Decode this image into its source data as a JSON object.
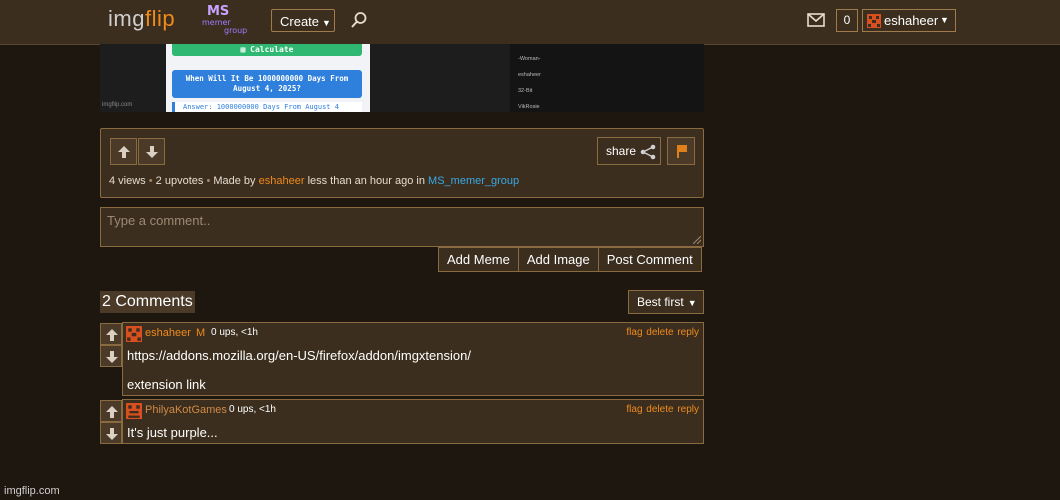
{
  "header": {
    "logo_img": "img",
    "logo_flip": "flip",
    "group_logo": {
      "ms": "MS",
      "line1": "memer",
      "line2": "group"
    },
    "create_label": "Create",
    "notification_count": "0",
    "username": "eshaheer",
    "icons": [
      "search-icon",
      "mail-icon",
      "avatar-icon",
      "caret-down-icon"
    ]
  },
  "meme": {
    "calculate_label": "▦ Calculate",
    "question": "When Will It Be 1000000000 Days From August 4, 2025?",
    "answer": "Answer: 1000000000 Days From August 4",
    "watermark": "imgflip.com",
    "sidebar": [
      "-Woman-",
      "eshaheer",
      "32-Bit",
      "VikRosie"
    ]
  },
  "post": {
    "views": "4 views",
    "upvotes": "2 upvotes",
    "made_by": "Made by",
    "author": "eshaheer",
    "time": "less than an hour ago in",
    "group": "MS_memer_group",
    "share_label": "share",
    "icons": [
      "upvote-icon",
      "downvote-icon",
      "share-icon",
      "flag-icon"
    ]
  },
  "comment_form": {
    "placeholder": "Type a comment..",
    "buttons": [
      "Add Meme",
      "Add Image",
      "Post Comment"
    ]
  },
  "comments_section": {
    "count_label": "2 Comments",
    "sort_label": "Best first",
    "comments": [
      {
        "user": "eshaheer",
        "badge": "M",
        "meta": "0 ups, <1h",
        "links": "flag delete reply",
        "lines": [
          "https://addons.mozilla.org/en-US/firefox/addon/imgxtension/",
          "extension link"
        ]
      },
      {
        "user": "PhilyaKotGames",
        "badge": "",
        "meta": "0 ups, <1h",
        "links": "flag delete reply",
        "lines": [
          "It's just purple..."
        ]
      }
    ]
  },
  "footer": {
    "watermark": "imgflip.com"
  },
  "colors": {
    "background": "#1e1710",
    "panel": "#3b2e1e",
    "border": "#8a6a3f",
    "accent": "#f08a1c",
    "link": "#39a9e6"
  }
}
